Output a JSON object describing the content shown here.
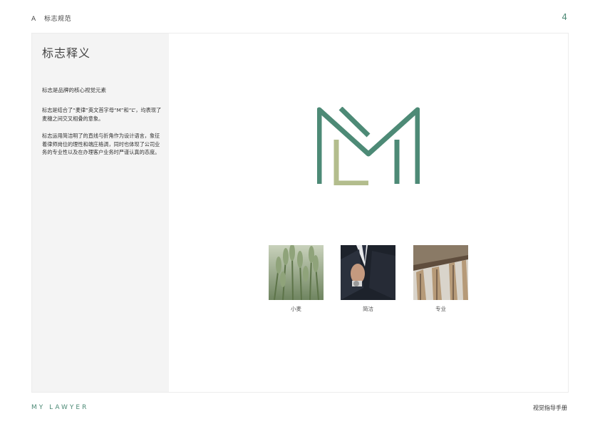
{
  "header": {
    "section_letter": "A",
    "section_title": "标志规范",
    "page_number": "4"
  },
  "sidebar": {
    "title": "标志释义",
    "lead": "标志是品牌的核心视觉元素",
    "paragraph_1": "标志是结合了“麦律”英文首字母“M”和“L”，均表现了麦穗之间交叉相叠的意象。",
    "paragraph_2": "标志运用简洁明了的直线与折角作为设计语言，象征着律师岗位的理性和端庄格调，同时也体现了公司业务的专业性以及在办理客户业务时严谨认真的态度。"
  },
  "images": [
    {
      "label": "小麦",
      "icon": "wheat-photo"
    },
    {
      "label": "简洁",
      "icon": "suit-photo"
    },
    {
      "label": "专业",
      "icon": "columns-photo"
    }
  ],
  "footer": {
    "brand": "MY LAWYER",
    "manual_title": "视觉指导手册"
  },
  "colors": {
    "green": "#4d8a76",
    "olive": "#b3bd8d",
    "sidebar_bg": "#f4f4f4"
  }
}
